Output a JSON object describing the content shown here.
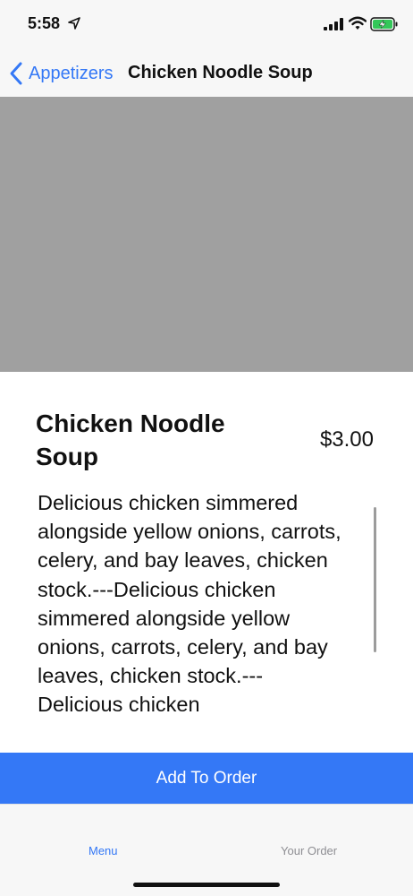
{
  "status_bar": {
    "time": "5:58"
  },
  "nav": {
    "back_label": "Appetizers",
    "title": "Chicken Noodle Soup"
  },
  "item": {
    "name": "Chicken Noodle Soup",
    "price": "$3.00",
    "description": "Delicious chicken simmered alongside yellow onions, carrots, celery, and bay leaves, chicken stock.---Delicious chicken simmered alongside yellow onions, carrots, celery, and bay leaves, chicken stock.---Delicious chicken"
  },
  "actions": {
    "add_to_order": "Add To Order"
  },
  "tabs": [
    {
      "label": "Menu",
      "selected": true
    },
    {
      "label": "Your Order",
      "selected": false
    }
  ],
  "colors": {
    "accent": "#3478f6",
    "image_placeholder": "#a0a0a0",
    "battery": "#34c759"
  }
}
